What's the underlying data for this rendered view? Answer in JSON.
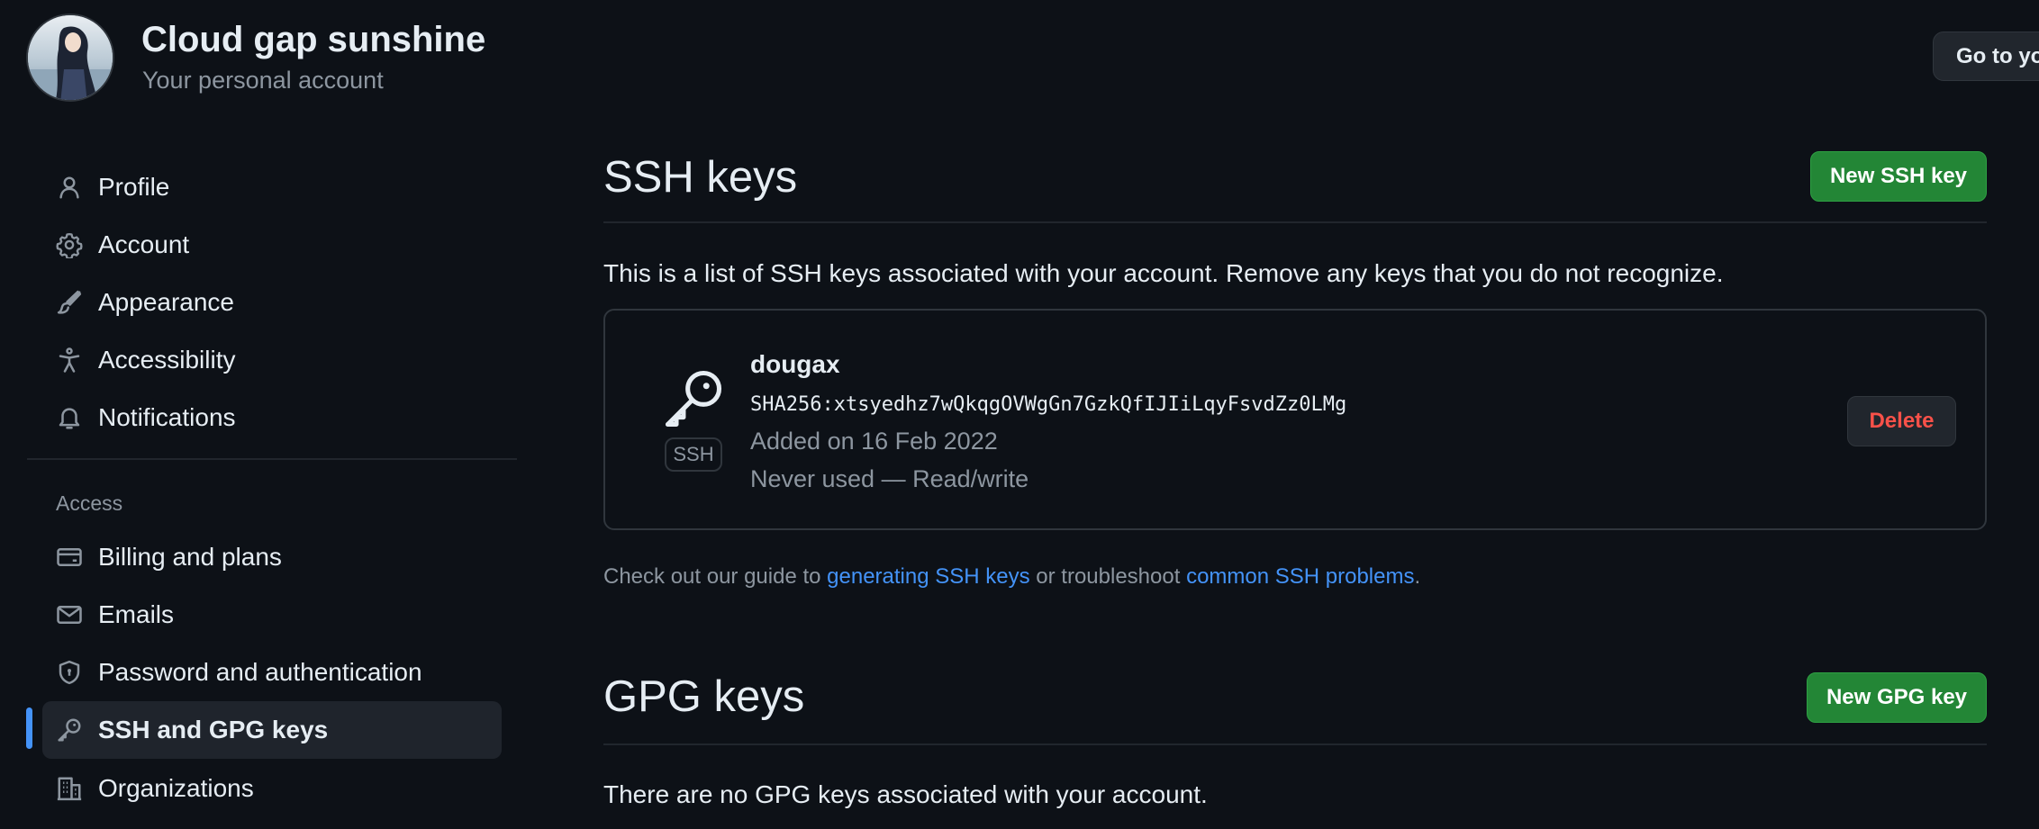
{
  "header": {
    "account_name": "Cloud gap sunshine",
    "account_sub": "Your personal account",
    "goto_label": "Go to yo"
  },
  "sidebar": {
    "items": [
      {
        "label": "Profile",
        "icon": "person-icon"
      },
      {
        "label": "Account",
        "icon": "gear-icon"
      },
      {
        "label": "Appearance",
        "icon": "paintbrush-icon"
      },
      {
        "label": "Accessibility",
        "icon": "accessibility-icon"
      },
      {
        "label": "Notifications",
        "icon": "bell-icon"
      }
    ],
    "access_heading": "Access",
    "access_items": [
      {
        "label": "Billing and plans",
        "icon": "credit-card-icon"
      },
      {
        "label": "Emails",
        "icon": "mail-icon"
      },
      {
        "label": "Password and authentication",
        "icon": "shield-lock-icon"
      },
      {
        "label": "SSH and GPG keys",
        "icon": "key-icon",
        "active": true
      },
      {
        "label": "Organizations",
        "icon": "organization-icon"
      }
    ]
  },
  "ssh": {
    "title": "SSH keys",
    "new_button": "New SSH key",
    "description": "This is a list of SSH keys associated with your account. Remove any keys that you do not recognize.",
    "key": {
      "badge": "SSH",
      "name": "dougax",
      "fingerprint": "SHA256:xtsyedhz7wQkqgOVWgGn7GzkQfIJIiLqyFsvdZz0LMg",
      "added": "Added on 16 Feb 2022",
      "usage": "Never used — Read/write",
      "delete_label": "Delete"
    },
    "guide": {
      "prefix": "Check out our guide to ",
      "link1": "generating SSH keys",
      "middle": " or troubleshoot ",
      "link2": "common SSH problems",
      "suffix": "."
    }
  },
  "gpg": {
    "title": "GPG keys",
    "new_button": "New GPG key",
    "description": "There are no GPG keys associated with your account."
  },
  "colors": {
    "background": "#0d1117",
    "text": "#e6edf3",
    "muted": "#8d96a0",
    "link": "#4493f8",
    "primary_button": "#238636",
    "danger": "#f85149",
    "border": "#30363d"
  }
}
